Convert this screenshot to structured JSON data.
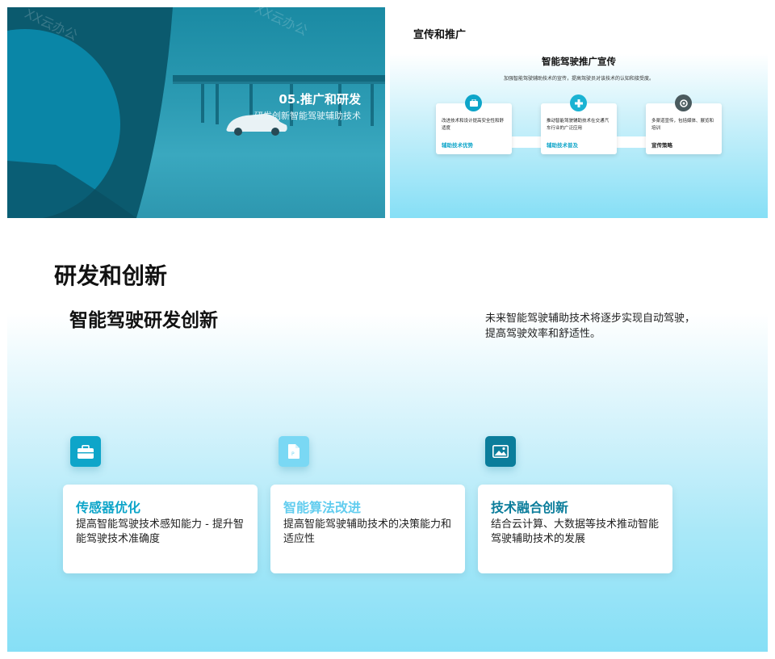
{
  "slide1": {
    "title": "05.推广和研发",
    "subtitle": "研发创新智能驾驶辅助技术",
    "watermark": "XX云办公",
    "watermark2": "XX云办公"
  },
  "slide2": {
    "heading": "宣传和推广",
    "center_title": "智能驾驶推广宣传",
    "center_subtitle": "加强智能驾驶辅助技术的宣传，提高驾驶员对该技术的认知和接受度。",
    "cards": [
      {
        "text": "改进技术和设计提高安全性和舒适度",
        "label": "辅助技术优势",
        "icon": "briefcase-icon"
      },
      {
        "text": "推动智能驾驶辅助技术在交通汽车行业的广泛应用",
        "label": "辅助技术普及",
        "icon": "medical-cross-icon"
      },
      {
        "text": "多渠道宣传，包括媒体、展览和培训",
        "label": "宣传策略",
        "icon": "target-icon"
      }
    ]
  },
  "slide3": {
    "heading": "研发和创新",
    "subheading": "智能驾驶研发创新",
    "description": "未来智能驾驶辅助技术将逐步实现自动驾驶，提高驾驶效率和舒适性。",
    "cards": [
      {
        "title": "传感器优化",
        "body": "提高智能驾驶技术感知能力 - 提升智能驾驶技术准确度",
        "icon": "briefcase-icon"
      },
      {
        "title": "智能算法改进",
        "body": "提高智能驾驶辅助技术的决策能力和适应性",
        "icon": "document-icon"
      },
      {
        "title": "技术融合创新",
        "body": "结合云计算、大数据等技术推动智能驾驶辅助技术的发展",
        "icon": "image-icon"
      }
    ]
  },
  "colors": {
    "accent": "#0ea5c9",
    "accent_light": "#3ec8ec",
    "accent_dark": "#0b7d9b",
    "icon_light": "#7ad8f4",
    "gray_icon": "#4a5a5e"
  }
}
